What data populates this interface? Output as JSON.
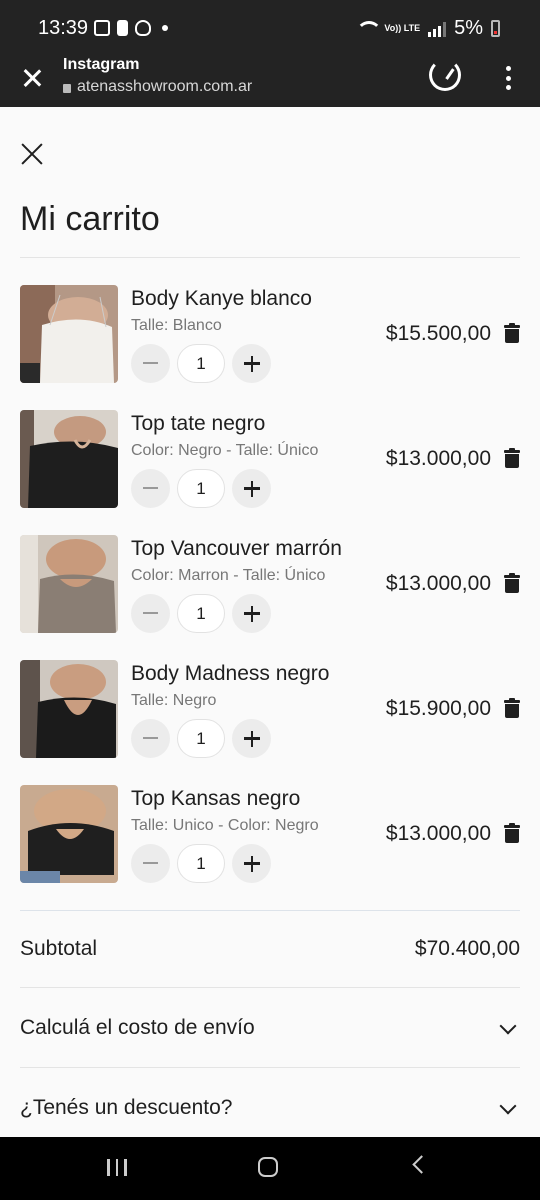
{
  "status_bar": {
    "time": "13:39",
    "volte": "Vo)) LTE",
    "battery": "5%"
  },
  "browser": {
    "app_title": "Instagram",
    "url": "atenasshowroom.com.ar"
  },
  "cart": {
    "title": "Mi carrito",
    "items": [
      {
        "name": "Body Kanye blanco",
        "variant": "Talle: Blanco",
        "qty": "1",
        "price": "$15.500,00"
      },
      {
        "name": "Top tate negro",
        "variant": "Color: Negro - Talle: Único",
        "qty": "1",
        "price": "$13.000,00"
      },
      {
        "name": "Top Vancouver marrón",
        "variant": "Color: Marron - Talle: Único",
        "qty": "1",
        "price": "$13.000,00"
      },
      {
        "name": "Body Madness negro",
        "variant": "Talle: Negro",
        "qty": "1",
        "price": "$15.900,00"
      },
      {
        "name": "Top Kansas negro",
        "variant": "Talle: Unico - Color: Negro",
        "qty": "1",
        "price": "$13.000,00"
      }
    ],
    "subtotal_label": "Subtotal",
    "subtotal_value": "$70.400,00",
    "shipping_label": "Calculá el costo de envío",
    "discount_label": "¿Tenés un descuento?"
  }
}
